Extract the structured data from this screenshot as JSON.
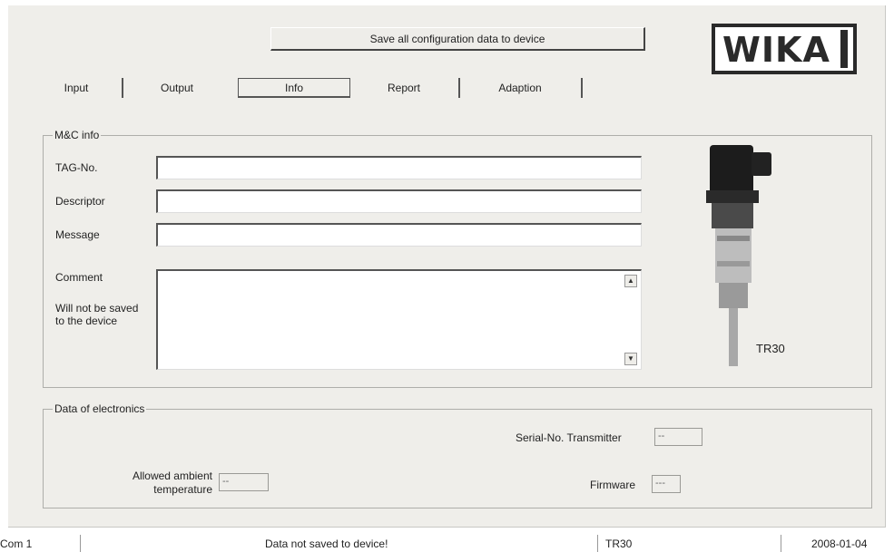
{
  "toolbar": {
    "save_label": "Save all configuration data to device"
  },
  "logo": {
    "text": "WIKA"
  },
  "tabs": [
    {
      "label": "Input"
    },
    {
      "label": "Output"
    },
    {
      "label": "Info"
    },
    {
      "label": "Report"
    },
    {
      "label": "Adaption"
    }
  ],
  "mc_info": {
    "title": "M&C info",
    "tag_label": "TAG-No.",
    "tag_value": "",
    "descriptor_label": "Descriptor",
    "descriptor_value": "",
    "message_label": "Message",
    "message_value": "",
    "comment_label": "Comment",
    "comment_note": "Will not be saved to the device",
    "comment_value": ""
  },
  "device": {
    "model": "TR30"
  },
  "electronics": {
    "title": "Data of electronics",
    "serial_label": "Serial-No. Transmitter",
    "serial_value": "--",
    "ambient_label_1": "Allowed ambient",
    "ambient_label_2": "temperature",
    "ambient_value": "--",
    "firmware_label": "Firmware",
    "firmware_value": "---"
  },
  "status": {
    "port": "Com 1",
    "message": "Data not saved to device!",
    "model": "TR30",
    "date": "2008-01-04"
  },
  "colors": {
    "background": "#efeeea",
    "field": "#ffffff"
  }
}
